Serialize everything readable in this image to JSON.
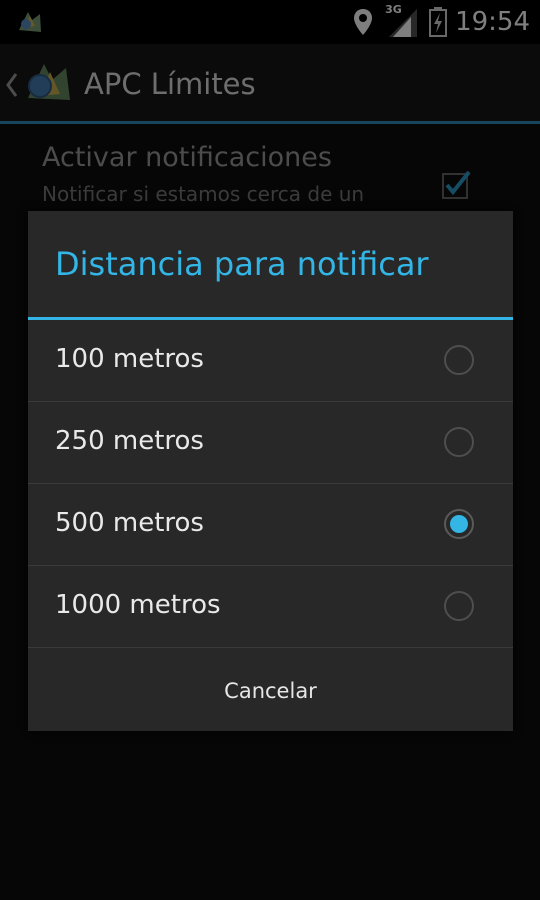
{
  "status_bar": {
    "time": "19:54",
    "network_label": "3G",
    "icons": [
      "app-notification-icon",
      "location-pin-icon",
      "signal-3g-icon",
      "battery-icon"
    ]
  },
  "action_bar": {
    "title": "APC Límites",
    "icons": [
      "up-chevron-icon",
      "app-logo-icon"
    ]
  },
  "preference": {
    "title": "Activar notificaciones",
    "summary": "Notificar si estamos cerca de un",
    "checked": true
  },
  "dialog": {
    "title": "Distancia para notificar",
    "options": [
      {
        "label": "100 metros",
        "selected": false
      },
      {
        "label": "250 metros",
        "selected": false
      },
      {
        "label": "500 metros",
        "selected": true
      },
      {
        "label": "1000 metros",
        "selected": false
      }
    ],
    "cancel_label": "Cancelar"
  },
  "colors": {
    "accent": "#33b5e5",
    "action_bar_divider": "#2a7fa6",
    "dialog_bg": "#282828",
    "text_primary": "#e9e9e9"
  }
}
